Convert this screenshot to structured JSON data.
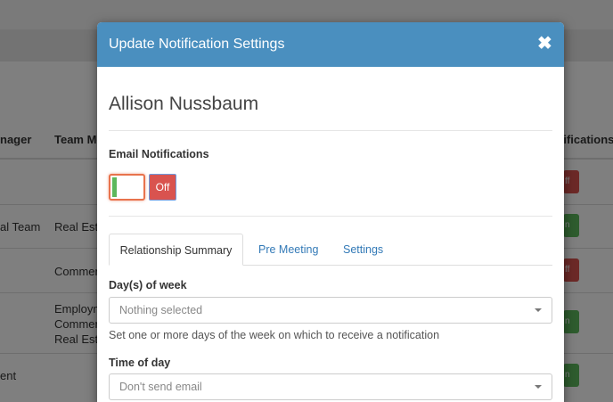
{
  "background": {
    "headers": [
      "nager",
      "Team Me",
      "tifications"
    ],
    "rows": [
      {
        "col1": "",
        "col2": "",
        "toggle": "ff",
        "state": "off"
      },
      {
        "col1": "al Team",
        "col2": "Real Est",
        "toggle": "n",
        "state": "on"
      },
      {
        "col1": "",
        "col2": "Commer",
        "toggle": "ff",
        "state": "off"
      },
      {
        "col1": "",
        "col2_lines": [
          "Employm",
          "Commer",
          "Real Est"
        ],
        "toggle": "n",
        "state": "on"
      },
      {
        "col1": "ent",
        "col2": "",
        "toggle": "n",
        "state": "on"
      }
    ]
  },
  "modal": {
    "title": "Update Notification Settings",
    "close_glyph": "✖",
    "person_name": "Allison Nussbaum",
    "email_label": "Email Notifications",
    "toggle": {
      "off_label": "Off",
      "state": "off"
    },
    "tabs": [
      {
        "label": "Relationship Summary",
        "active": true
      },
      {
        "label": "Pre Meeting",
        "active": false
      },
      {
        "label": "Settings",
        "active": false
      }
    ],
    "days_label": "Day(s) of week",
    "days_placeholder": "Nothing selected",
    "days_help": "Set one or more days of the week on which to receive a notification",
    "time_label": "Time of day",
    "time_value": "Don't send email"
  },
  "colors": {
    "header_blue": "#4a8fbf",
    "danger": "#d9534f",
    "success": "#5cb85c",
    "link": "#337ab7"
  }
}
